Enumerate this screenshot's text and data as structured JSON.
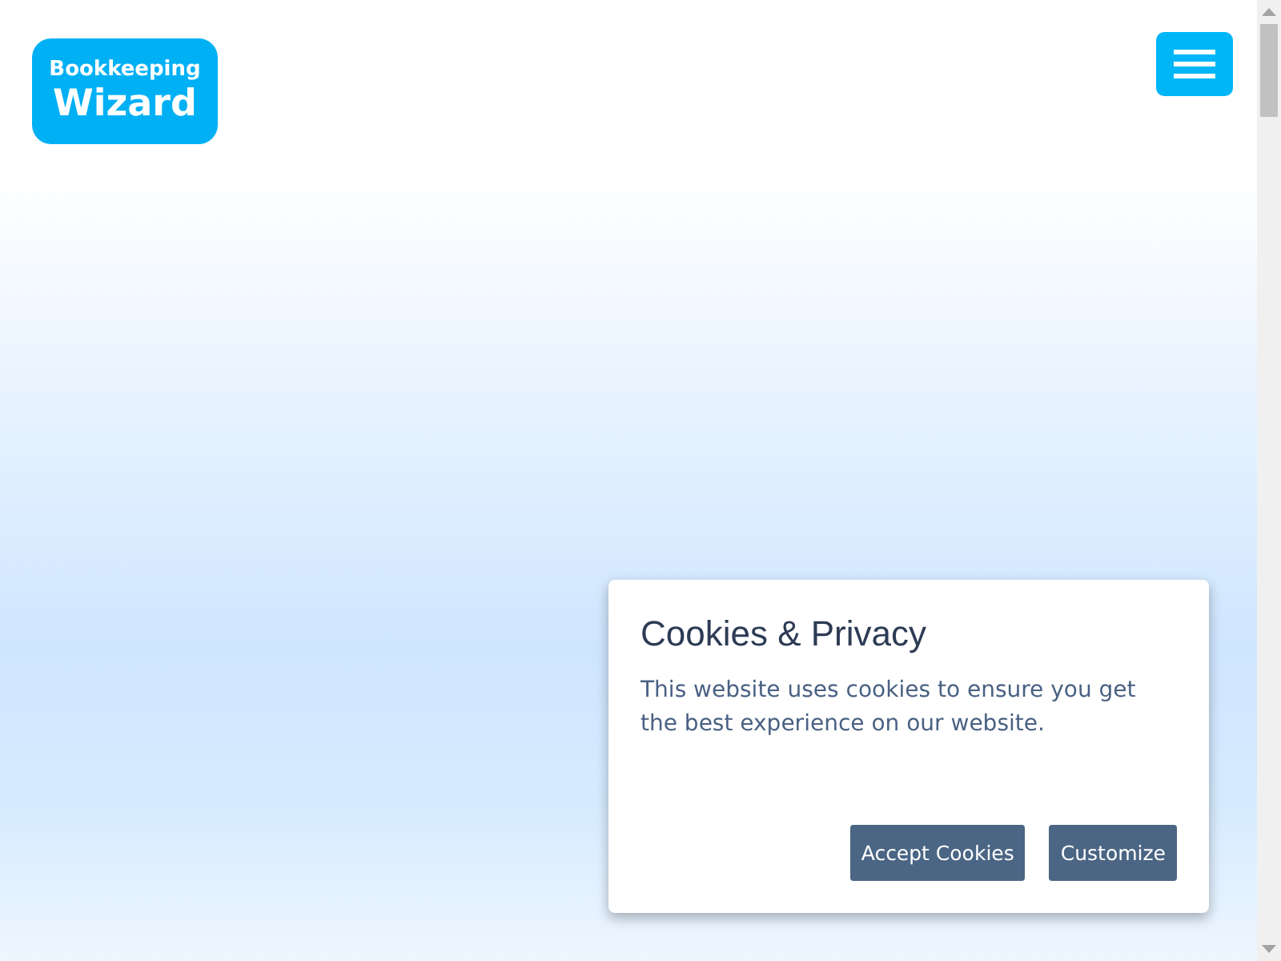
{
  "logo": {
    "line_1": "Bookkeeping",
    "line_2": "Wizard"
  },
  "cookie_dialog": {
    "title": "Cookies & Privacy",
    "message": "This website uses cookies to ensure you get the best experience on our website.",
    "buttons": [
      "Accept Cookies",
      "Customize"
    ]
  }
}
